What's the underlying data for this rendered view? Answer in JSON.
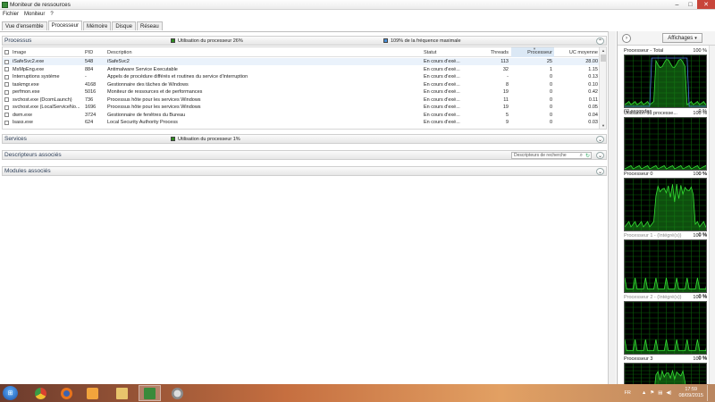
{
  "window": {
    "title": "Moniteur de ressources",
    "min": "–",
    "max": "□",
    "close": "✕"
  },
  "menu": [
    "Fichier",
    "Moniteur",
    "?"
  ],
  "tabs": [
    {
      "label": "Vue d'ensemble",
      "active": false
    },
    {
      "label": "Processeur",
      "active": true
    },
    {
      "label": "Mémoire",
      "active": false
    },
    {
      "label": "Disque",
      "active": false
    },
    {
      "label": "Réseau",
      "active": false
    }
  ],
  "processes_section": {
    "title": "Processus",
    "stat_usage": "Utilisation du processeur 26%",
    "stat_usage_color": "#2e8b1f",
    "stat_freq": "109% de la fréquence maximale",
    "stat_freq_color": "#4a90d9",
    "columns": {
      "image": "Image",
      "pid": "PID",
      "description": "Description",
      "status": "Statut",
      "threads": "Threads",
      "cpu": "Processeur",
      "avg": "UC moyenne"
    },
    "rows": [
      {
        "image": "iSafeSvc2.exe",
        "pid": "548",
        "description": "iSafeSvc2",
        "status": "En cours d'exé...",
        "threads": "113",
        "cpu": "25",
        "avg": "28.00",
        "selected": true
      },
      {
        "image": "MsMpEng.exe",
        "pid": "884",
        "description": "Antimalware Service Executable",
        "status": "En cours d'exé...",
        "threads": "32",
        "cpu": "1",
        "avg": "1.15",
        "selected": false
      },
      {
        "image": "Interruptions système",
        "pid": "-",
        "description": "Appels de procédure différés et routines du service d'interruption",
        "status": "En cours d'exé...",
        "threads": "-",
        "cpu": "0",
        "avg": "0.13",
        "selected": false
      },
      {
        "image": "taskmgr.exe",
        "pid": "4168",
        "description": "Gestionnaire des tâches de Windows",
        "status": "En cours d'exé...",
        "threads": "8",
        "cpu": "0",
        "avg": "0.10",
        "selected": false
      },
      {
        "image": "perfmon.exe",
        "pid": "5016",
        "description": "Moniteur de ressources et de performances",
        "status": "En cours d'exé...",
        "threads": "19",
        "cpu": "0",
        "avg": "0.42",
        "selected": false
      },
      {
        "image": "svchost.exe (DcomLaunch)",
        "pid": "736",
        "description": "Processus hôte pour les services Windows",
        "status": "En cours d'exé...",
        "threads": "11",
        "cpu": "0",
        "avg": "0.11",
        "selected": false
      },
      {
        "image": "svchost.exe (LocalServiceNo...",
        "pid": "1696",
        "description": "Processus hôte pour les services Windows",
        "status": "En cours d'exé...",
        "threads": "19",
        "cpu": "0",
        "avg": "0.05",
        "selected": false
      },
      {
        "image": "dwm.exe",
        "pid": "3724",
        "description": "Gestionnaire de fenêtres du Bureau",
        "status": "En cours d'exé...",
        "threads": "5",
        "cpu": "0",
        "avg": "0.04",
        "selected": false
      },
      {
        "image": "lsass.exe",
        "pid": "624",
        "description": "Local Security Authority Process",
        "status": "En cours d'exé...",
        "threads": "9",
        "cpu": "0",
        "avg": "0.03",
        "selected": false
      }
    ]
  },
  "services_section": {
    "title": "Services",
    "stat": "Utilisation du processeur 1%",
    "stat_color": "#2e8b1f"
  },
  "handles_section": {
    "title": "Descripteurs associés",
    "search_placeholder": "Descripteurs de recherche"
  },
  "modules_section": {
    "title": "Modules associés"
  },
  "right_panel": {
    "views_label": "Affichages",
    "graphs": [
      {
        "label": "Processeur - Total",
        "top_pct": "100 %",
        "foot_left": "60 secondes",
        "foot_right": "0 %",
        "disabled": false
      },
      {
        "label": "Utilisation du processe...",
        "top_pct": "100 %",
        "foot_left": "",
        "foot_right": "0 %",
        "disabled": false
      },
      {
        "label": "Processeur 0",
        "top_pct": "100 %",
        "foot_left": "",
        "foot_right": "0 %",
        "disabled": false
      },
      {
        "label": "Processeur 1 - (Intégré(s))",
        "top_pct": "100 %",
        "foot_left": "",
        "foot_right": "0 %",
        "disabled": true
      },
      {
        "label": "Processeur 2 - (Intégré(s))",
        "top_pct": "100 %",
        "foot_left": "",
        "foot_right": "0 %",
        "disabled": true
      },
      {
        "label": "Processeur 3",
        "top_pct": "100 %",
        "foot_left": "",
        "foot_right": "",
        "disabled": false
      }
    ]
  },
  "taskbar": {
    "apps": [
      "windows-explorer-icon",
      "chrome-icon",
      "firefox-icon",
      "media-player-icon",
      "file-explorer-icon",
      "resource-monitor-icon",
      "speed-icon"
    ],
    "lang": "FR",
    "time": "17:59",
    "date": "08/09/2015"
  }
}
